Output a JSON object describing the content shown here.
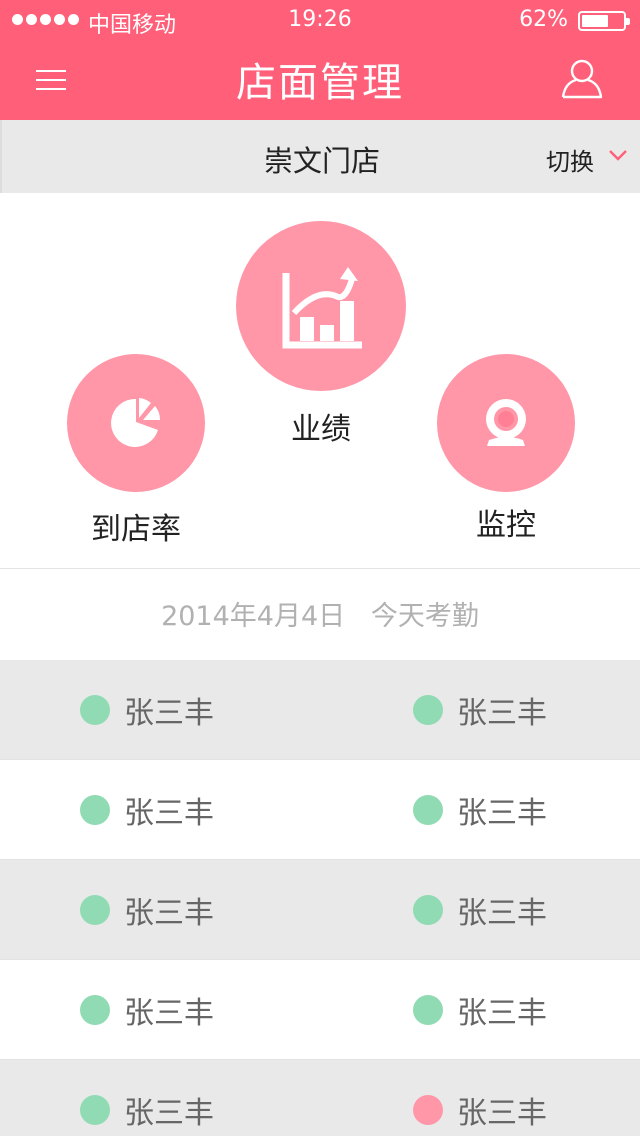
{
  "status_bar": {
    "carrier": "中国移动",
    "time": "19:26",
    "battery": "62%",
    "battery_level": 0.62
  },
  "header": {
    "title": "店面管理",
    "menu_icon": "hamburger-menu-icon",
    "user_icon": "user-profile-icon"
  },
  "store_bar": {
    "store_name": "崇文门店",
    "switch_label": "切换",
    "switch_icon": "chevron-down-icon"
  },
  "features": {
    "performance": {
      "label": "业绩",
      "icon": "growth-chart-icon"
    },
    "visit_rate": {
      "label": "到店率",
      "icon": "pie-chart-icon"
    },
    "monitor": {
      "label": "监控",
      "icon": "webcam-icon"
    }
  },
  "attendance": {
    "date": "2014年4月4日",
    "label": "今天考勤",
    "rows": [
      [
        {
          "name": "张三丰",
          "status": "present"
        },
        {
          "name": "张三丰",
          "status": "present"
        }
      ],
      [
        {
          "name": "张三丰",
          "status": "present"
        },
        {
          "name": "张三丰",
          "status": "present"
        }
      ],
      [
        {
          "name": "张三丰",
          "status": "present"
        },
        {
          "name": "张三丰",
          "status": "present"
        }
      ],
      [
        {
          "name": "张三丰",
          "status": "present"
        },
        {
          "name": "张三丰",
          "status": "present"
        }
      ],
      [
        {
          "name": "张三丰",
          "status": "present"
        },
        {
          "name": "张三丰",
          "status": "absent"
        }
      ]
    ]
  },
  "colors": {
    "brand": "#ff5f78",
    "circle": "#ff97a8",
    "present": "#90dbb3",
    "absent": "#ff97a8"
  }
}
